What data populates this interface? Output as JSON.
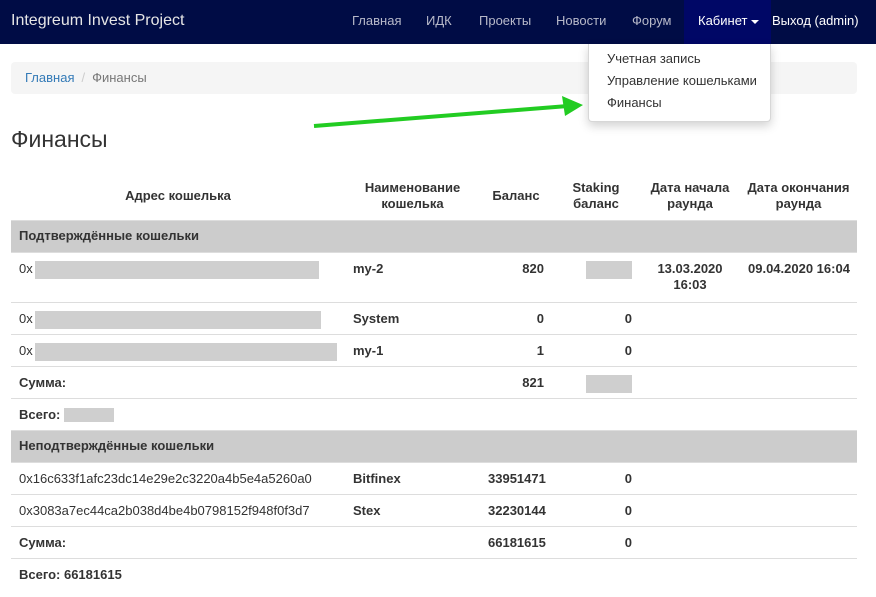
{
  "navbar": {
    "brand": "Integreum Invest Project",
    "items": [
      "Главная",
      "ИДК",
      "Проекты",
      "Новости",
      "Форум"
    ],
    "cabinet": "Кабинет",
    "logout": "Выход (admin)"
  },
  "dropdown": {
    "items": [
      "Учетная запись",
      "Управление кошельками",
      "Финансы"
    ]
  },
  "breadcrumb": {
    "home": "Главная",
    "current": "Финансы"
  },
  "page_title": "Финансы",
  "table": {
    "headers": {
      "address": "Адрес кошелька",
      "name": "Наименование кошелька",
      "balance": "Баланс",
      "staking": "Staking баланс",
      "start": "Дата начала раунда",
      "end": "Дата окончания раунда"
    },
    "confirmed": {
      "title": "Подтверждённые кошельки",
      "rows": [
        {
          "addr_prefix": "0x",
          "name": "my-2",
          "balance": "820",
          "staking": "",
          "start": "13.03.2020 16:03",
          "end": "09.04.2020 16:04"
        },
        {
          "addr_prefix": "0x",
          "name": "System",
          "balance": "0",
          "staking": "0",
          "start": "",
          "end": ""
        },
        {
          "addr_prefix": "0x",
          "name": "my-1",
          "balance": "1",
          "staking": "0",
          "start": "",
          "end": ""
        }
      ],
      "sum_label": "Сумма:",
      "sum_balance": "821",
      "total_label": "Всего:"
    },
    "unconfirmed": {
      "title": "Неподтверждённые кошельки",
      "rows": [
        {
          "address": "0x16c633f1afc23dc14e29e2c3220a4b5e4a5260a0",
          "name": "Bitfinex",
          "balance": "33951471",
          "staking": "0"
        },
        {
          "address": "0x3083a7ec44ca2b038d4be4b0798152f948f0f3d7",
          "name": "Stex",
          "balance": "32230144",
          "staking": "0"
        }
      ],
      "sum_label": "Сумма:",
      "sum_balance": "66181615",
      "sum_staking": "0",
      "total": "Всего: 66181615"
    }
  },
  "colors": {
    "navbar": "#000c45",
    "navbar_active": "#000766",
    "group_row": "#cccccc",
    "link": "#337ab7",
    "arrow": "#22cc22"
  }
}
